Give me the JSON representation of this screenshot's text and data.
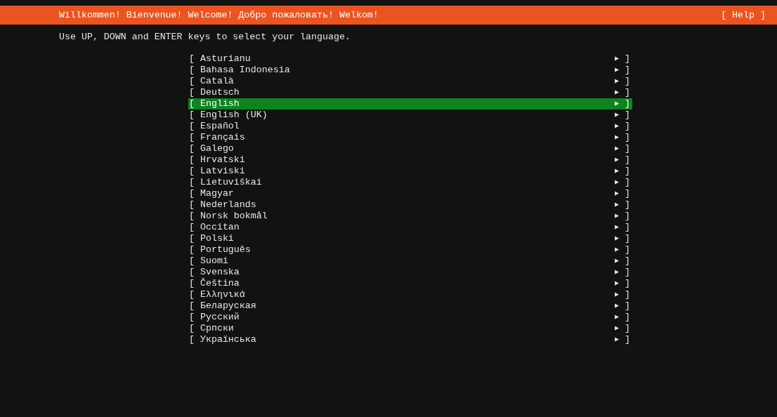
{
  "header": {
    "title": "Willkommen! Bienvenue! Welcome! Добро пожаловать! Welkom!",
    "help": "[ Help ]"
  },
  "instruction": "Use UP, DOWN and ENTER keys to select your language.",
  "languages": [
    {
      "open": "[",
      "label": "Asturianu",
      "arrow": "▶",
      "close": "]",
      "selected": false
    },
    {
      "open": "[",
      "label": "Bahasa Indonesia",
      "arrow": "▶",
      "close": "]",
      "selected": false
    },
    {
      "open": "[",
      "label": "Català",
      "arrow": "▶",
      "close": "]",
      "selected": false
    },
    {
      "open": "[",
      "label": "Deutsch",
      "arrow": "▶",
      "close": "]",
      "selected": false
    },
    {
      "open": "[",
      "label": "English",
      "arrow": "▶",
      "close": "]",
      "selected": true
    },
    {
      "open": "[",
      "label": "English (UK)",
      "arrow": "▶",
      "close": "]",
      "selected": false
    },
    {
      "open": "[",
      "label": "Español",
      "arrow": "▶",
      "close": "]",
      "selected": false
    },
    {
      "open": "[",
      "label": "Français",
      "arrow": "▶",
      "close": "]",
      "selected": false
    },
    {
      "open": "[",
      "label": "Galego",
      "arrow": "▶",
      "close": "]",
      "selected": false
    },
    {
      "open": "[",
      "label": "Hrvatski",
      "arrow": "▶",
      "close": "]",
      "selected": false
    },
    {
      "open": "[",
      "label": "Latviski",
      "arrow": "▶",
      "close": "]",
      "selected": false
    },
    {
      "open": "[",
      "label": "Lietuviškai",
      "arrow": "▶",
      "close": "]",
      "selected": false
    },
    {
      "open": "[",
      "label": "Magyar",
      "arrow": "▶",
      "close": "]",
      "selected": false
    },
    {
      "open": "[",
      "label": "Nederlands",
      "arrow": "▶",
      "close": "]",
      "selected": false
    },
    {
      "open": "[",
      "label": "Norsk bokmål",
      "arrow": "▶",
      "close": "]",
      "selected": false
    },
    {
      "open": "[",
      "label": "Occitan",
      "arrow": "▶",
      "close": "]",
      "selected": false
    },
    {
      "open": "[",
      "label": "Polski",
      "arrow": "▶",
      "close": "]",
      "selected": false
    },
    {
      "open": "[",
      "label": "Português",
      "arrow": "▶",
      "close": "]",
      "selected": false
    },
    {
      "open": "[",
      "label": "Suomi",
      "arrow": "▶",
      "close": "]",
      "selected": false
    },
    {
      "open": "[",
      "label": "Svenska",
      "arrow": "▶",
      "close": "]",
      "selected": false
    },
    {
      "open": "[",
      "label": "Čeština",
      "arrow": "▶",
      "close": "]",
      "selected": false
    },
    {
      "open": "[",
      "label": "Ελληνικά",
      "arrow": "▶",
      "close": "]",
      "selected": false
    },
    {
      "open": "[",
      "label": "Беларуская",
      "arrow": "▶",
      "close": "]",
      "selected": false
    },
    {
      "open": "[",
      "label": "Русский",
      "arrow": "▶",
      "close": "]",
      "selected": false
    },
    {
      "open": "[",
      "label": "Српски",
      "arrow": "▶",
      "close": "]",
      "selected": false
    },
    {
      "open": "[",
      "label": "Українська",
      "arrow": "▶",
      "close": "]",
      "selected": false
    }
  ]
}
